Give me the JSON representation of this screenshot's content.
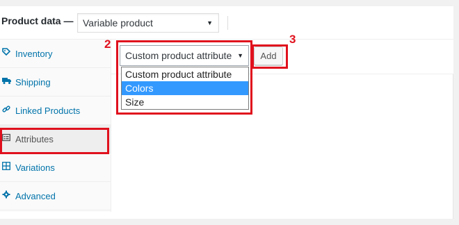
{
  "header": {
    "label": "Product data —",
    "product_type": "Variable product"
  },
  "sidebar": {
    "tabs": [
      {
        "label": "Inventory",
        "icon": "diamond-tag-icon"
      },
      {
        "label": "Shipping",
        "icon": "truck-icon"
      },
      {
        "label": "Linked Products",
        "icon": "link-icon"
      },
      {
        "label": "Attributes",
        "icon": "list-card-icon",
        "active": true
      },
      {
        "label": "Variations",
        "icon": "grid-icon"
      },
      {
        "label": "Advanced",
        "icon": "gear-icon"
      }
    ]
  },
  "attributes": {
    "select_value": "Custom product attribute",
    "add_label": "Add",
    "options": [
      {
        "label": "Custom product attribute"
      },
      {
        "label": "Colors",
        "highlighted": true
      },
      {
        "label": "Size"
      }
    ]
  },
  "annotations": {
    "step_2": "2",
    "step_3": "3",
    "color": "#e0111d"
  }
}
